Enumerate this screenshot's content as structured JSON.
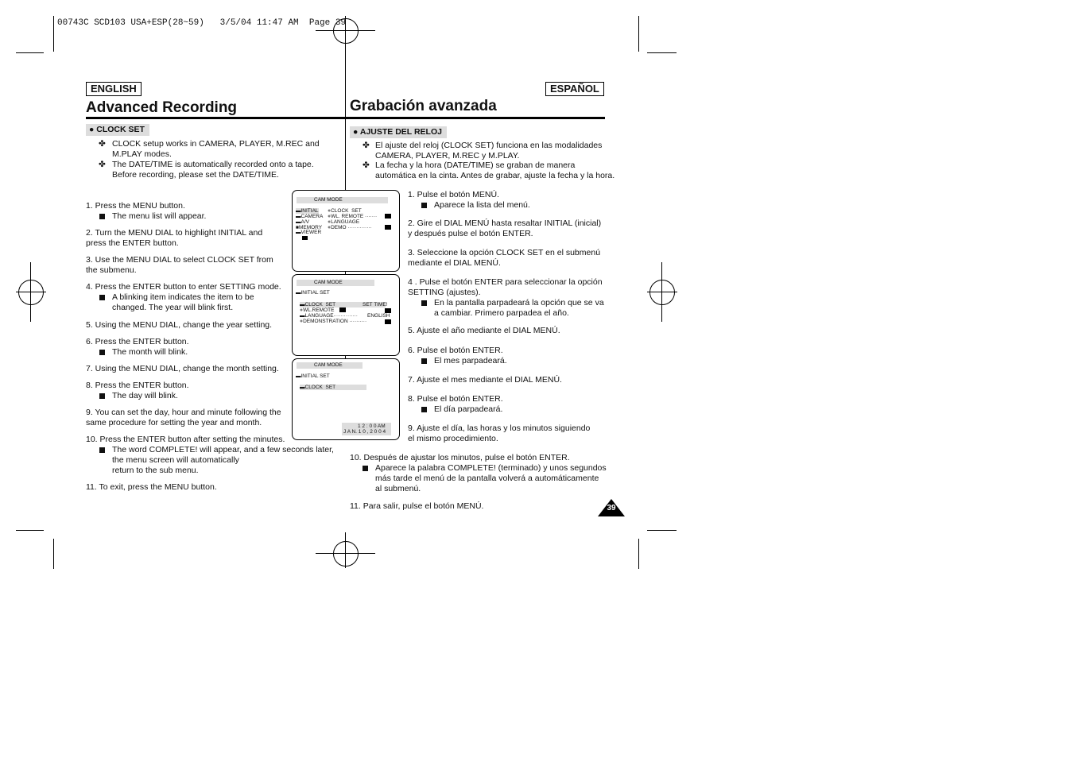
{
  "slug": "00743C SCD103 USA+ESP(28~59)   3/5/04 11:47 AM  Page 39",
  "english": {
    "lang_label": "ENGLISH",
    "title": "Advanced Recording",
    "section": "CLOCK SET",
    "notes": [
      "CLOCK setup works in CAMERA, PLAYER, M.REC and\nM.PLAY modes.",
      "The DATE/TIME is automatically recorded onto a tape.\nBefore recording, please set the DATE/TIME."
    ],
    "steps": [
      {
        "text": "1.  Press the MENU button.",
        "sub": "The menu list will appear."
      },
      {
        "text": "2.  Turn the MENU DIAL to highlight INITIAL and\n     press the ENTER button."
      },
      {
        "text": "3.  Use the MENU DIAL to select CLOCK SET from\n     the submenu."
      },
      {
        "text": "4.  Press the ENTER button to enter SETTING mode.",
        "sub": "A blinking item indicates the item to be\nchanged. The year will blink first."
      },
      {
        "text": "5.  Using the MENU DIAL, change the year setting."
      },
      {
        "text": "6.  Press the ENTER button.",
        "sub": "The month will blink."
      },
      {
        "text": "7.  Using the MENU DIAL, change the month setting."
      },
      {
        "text": "8.  Press the ENTER button.",
        "sub": "The day will blink."
      },
      {
        "text": "9.  You can set the day, hour and minute following the\n     same procedure for setting the year and month."
      },
      {
        "text": "10. Press the ENTER button after setting the minutes.",
        "sub": "The word COMPLETE! will appear, and a few seconds later,\nthe menu screen will automatically\nreturn to the sub menu."
      },
      {
        "text": "11. To exit, press the MENU button."
      }
    ]
  },
  "spanish": {
    "lang_label": "ESPAÑOL",
    "title": "Grabación avanzada",
    "section": "AJUSTE DEL RELOJ",
    "notes": [
      "El ajuste del reloj (CLOCK SET) funciona en las modalidades\nCAMERA, PLAYER, M.REC y M.PLAY.",
      "La fecha y la hora (DATE/TIME) se graban de manera\nautomática en la cinta. Antes de grabar, ajuste la fecha y la hora."
    ],
    "steps": [
      {
        "text": "1.  Pulse el botón MENÚ.",
        "sub": "Aparece la lista del menú."
      },
      {
        "text": "2.  Gire el DIAL MENÚ hasta resaltar INITIAL (inicial)\n     y después pulse el botón ENTER."
      },
      {
        "text": "3.  Seleccione la opción CLOCK SET en el submenú\n     mediante el DIAL MENÚ."
      },
      {
        "text": "4 . Pulse el botón ENTER para seleccionar la opción\n     SETTING (ajustes).",
        "sub": "En la pantalla parpadeará la opción que se va\na cambiar. Primero parpadea el año."
      },
      {
        "text": "5.  Ajuste el año mediante el DIAL MENÚ."
      },
      {
        "text": "6.  Pulse el botón ENTER.",
        "sub": "El mes parpadeará."
      },
      {
        "text": "7.  Ajuste el mes mediante el DIAL MENÚ."
      },
      {
        "text": "8.  Pulse el botón ENTER.",
        "sub": "El día parpadeará."
      },
      {
        "text": "9.  Ajuste el día, las horas y los minutos siguiendo\n     el mismo procedimiento."
      },
      {
        "text": "10. Después de ajustar los minutos, pulse el botón ENTER.",
        "sub": "Aparece la palabra COMPLETE! (terminado) y unos segundos\nmás tarde el menú de la pantalla volverá a automáticamente\nal submenú."
      },
      {
        "text": "11. Para salir, pulse el botón MENÚ."
      }
    ]
  },
  "screens": {
    "s1": {
      "header": "CAM MODE",
      "left": [
        "INITIAL",
        "CAMERA",
        "A/V",
        "MEMORY",
        "VIEWER"
      ],
      "right": [
        "CLOCK  SET",
        "WL. REMOTE",
        "LANGUAGE",
        "DEMO"
      ]
    },
    "s2": {
      "header": "CAM MODE",
      "root": "INITIAL SET",
      "items": [
        "CLOCK  SET",
        "WL.REMOTE",
        "LANGUAGE",
        "DEMONSTRATION"
      ],
      "clock_value": "SET TIME!",
      "language_value": "ENGLISH"
    },
    "s3": {
      "header": "CAM MODE",
      "root": "INITIAL SET",
      "item": "CLOCK  SET",
      "time": "1 2 : 0 0 AM",
      "date": "J A N. 1 0 , 2 0 0 4"
    }
  },
  "page_number": "39"
}
